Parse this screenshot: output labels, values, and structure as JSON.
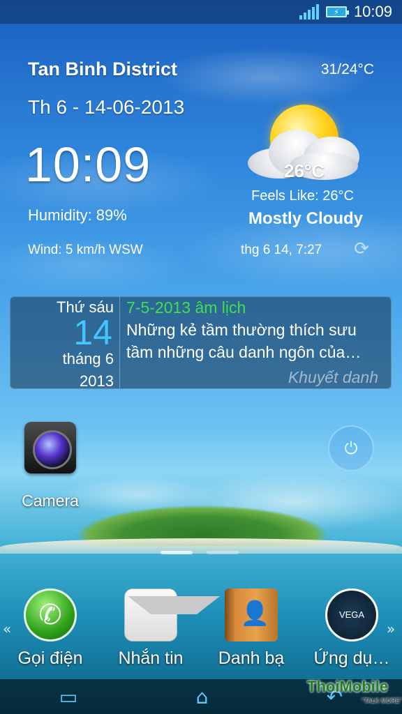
{
  "status_bar": {
    "time": "10:09",
    "battery_symbol": "⚡"
  },
  "weather": {
    "location": "Tan Binh District",
    "temp_range": "31/24°C",
    "date": "Th 6 - 14-06-2013",
    "time": "10:09",
    "humidity": "Humidity: 89%",
    "wind": "Wind: 5 km/h WSW",
    "current_temp": "26°C",
    "feels_like": "Feels Like: 26°C",
    "condition": "Mostly Cloudy",
    "updated": "thg 6 14, 7:27",
    "icon": "partly-cloudy-icon"
  },
  "calendar": {
    "weekday": "Thứ sáu",
    "day": "14",
    "month": "tháng 6",
    "year": "2013",
    "lunar_date": "7-5-2013 âm lịch",
    "quote": "Những kẻ tầm thường thích sưu tầm những câu danh ngôn của…",
    "author": "Khuyết danh"
  },
  "desktop": {
    "camera_label": "Camera",
    "power_icon": "⏻"
  },
  "dock": {
    "left_arrow": "«",
    "right_arrow": "»",
    "items": [
      {
        "label": "Gọi điện",
        "icon": "phone-icon"
      },
      {
        "label": "Nhắn tin",
        "icon": "message-icon"
      },
      {
        "label": "Danh bạ",
        "icon": "contacts-icon"
      },
      {
        "label": "Ứng dụ…",
        "icon": "apps-icon"
      }
    ]
  },
  "nav": {
    "recent": "▭",
    "home": "⌂",
    "back": "↶"
  },
  "watermark": {
    "brand": "ThoiMobile",
    "tagline": "\"TALK MORE\""
  },
  "colors": {
    "accent": "#43c6ff",
    "lunar": "#3fe04c"
  }
}
